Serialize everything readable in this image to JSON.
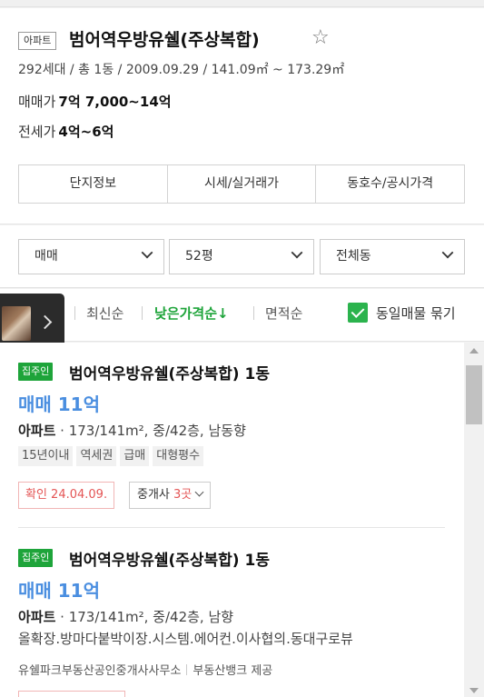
{
  "complex": {
    "type_badge": "아파트",
    "name": "범어역우방유쉘(주상복합)",
    "star_glyph": "☆",
    "summary": "292세대 / 총 1동 / 2009.09.29 / 141.09㎡ ~ 173.29㎡",
    "sale_label": "매매가",
    "sale_value": "7억 7,000~14억",
    "lease_label": "전세가",
    "lease_value": "4억~6억"
  },
  "tabs": [
    {
      "label": "단지정보"
    },
    {
      "label": "시세/실거래가"
    },
    {
      "label": "동호수/공시가격"
    }
  ],
  "filters": {
    "deal_type": "매매",
    "size": "52평",
    "dong": "전체동"
  },
  "sort": {
    "options": [
      {
        "label": "최신순",
        "active": false
      },
      {
        "label": "낮은가격순↓",
        "active": true
      },
      {
        "label": "면적순",
        "active": false
      }
    ],
    "group_checkbox_label": "동일매물 묶기",
    "group_checked": true
  },
  "listings": [
    {
      "badge": "집주인",
      "title": "범어역우방유쉘(주상복합) 1동",
      "price": "매매 11억",
      "spec_type": "아파트",
      "spec_rest": " · 173/141m², 중/42층, 남동향",
      "tags": [
        "15년이내",
        "역세권",
        "급매",
        "대형평수"
      ],
      "confirm": "확인 24.04.09.",
      "agents_label": "중개사",
      "agents_count": "3곳"
    },
    {
      "badge": "집주인",
      "title": "범어역우방유쉘(주상복합) 1동",
      "price": "매매 11억",
      "spec_type": "아파트",
      "spec_rest": " · 173/141m², 중/42층, 남향",
      "description": "올확장.방마다붙박이장.시스템.에어컨.이사협의.동대구로뷰",
      "agency": "유쉘파크부동산공인중개사사무소",
      "provider": "부동산뱅크 제공"
    }
  ],
  "colors": {
    "accent_green": "#1ea43a",
    "price_blue": "#4a8ee0",
    "confirm_red": "#e45555"
  },
  "icons": {
    "star": "star-outline-icon",
    "dropdown": "chevron-down-icon",
    "photo_next": "chevron-right-icon",
    "check": "checkmark-icon"
  }
}
